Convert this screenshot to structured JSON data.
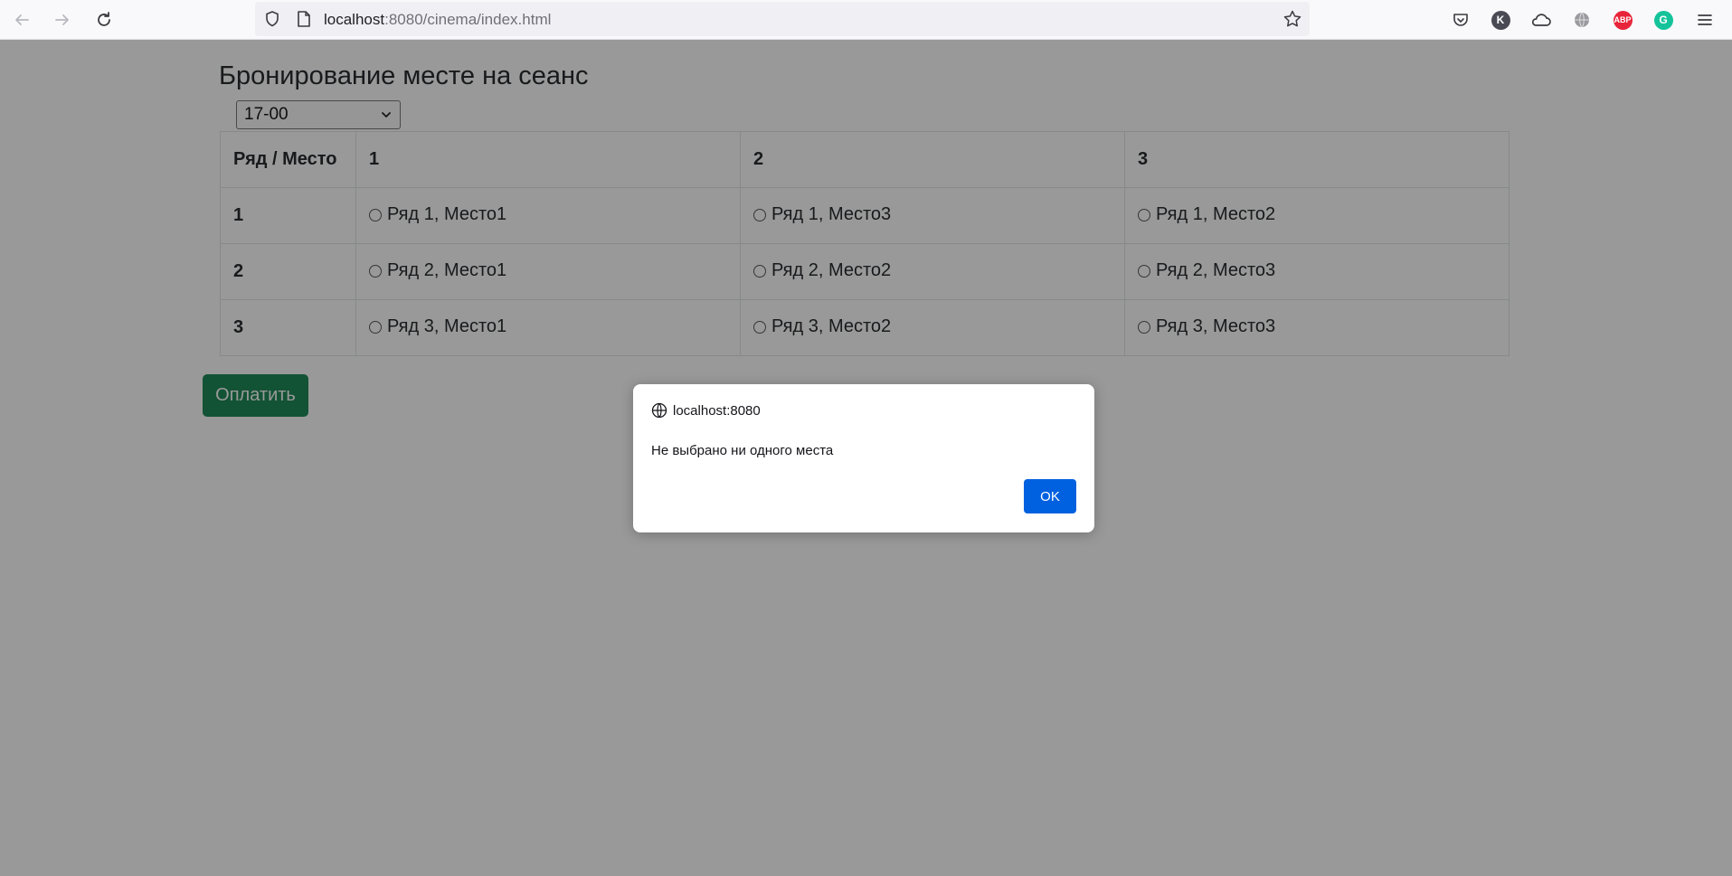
{
  "browser": {
    "url_host": "localhost",
    "url_rest": ":8080/cinema/index.html",
    "extensions": [
      {
        "name": "K",
        "color": "#4a4a55"
      },
      {
        "name": "ABP",
        "color": "#e8243a"
      },
      {
        "name": "G",
        "color": "#15c39a"
      }
    ]
  },
  "page": {
    "title": "Бронирование месте на сеанс",
    "session_select": {
      "selected": "17-00"
    },
    "table": {
      "headers": [
        "Ряд / Место",
        "1",
        "2",
        "3"
      ],
      "rows": [
        {
          "row": "1",
          "seats": [
            "Ряд 1, Место1",
            "Ряд 1, Место3",
            "Ряд 1, Место2"
          ]
        },
        {
          "row": "2",
          "seats": [
            "Ряд 2, Место1",
            "Ряд 2, Место2",
            "Ряд 2, Место3"
          ]
        },
        {
          "row": "3",
          "seats": [
            "Ряд 3, Место1",
            "Ряд 3, Место2",
            "Ряд 3, Место3"
          ]
        }
      ]
    },
    "pay_button": "Оплатить",
    "pay_button_color": "#198754"
  },
  "dialog": {
    "origin": "localhost:8080",
    "message": "Не выбрано ни одного места",
    "ok_label": "OK",
    "ok_color": "#0061e0"
  }
}
